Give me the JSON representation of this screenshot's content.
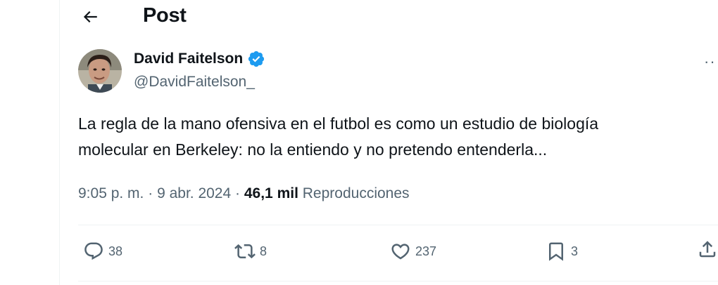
{
  "header": {
    "title": "Post",
    "back_icon": "arrow-left-icon"
  },
  "author": {
    "name": "David Faitelson",
    "handle": "@DavidFaitelson_",
    "verified": true,
    "verified_color": "#1d9bf0"
  },
  "tweet": {
    "text_line1": "La regla de la mano ofensiva en el futbol es como un estudio de biología",
    "text_line2": "molecular en Berkeley: no la entiendo y no pretendo entenderla...",
    "time": "9:05 p. m.",
    "separator": "·",
    "date": "9 abr. 2024",
    "views_count": "46,1 mil",
    "views_label": "Reproducciones"
  },
  "actions": {
    "replies": "38",
    "reposts": "8",
    "likes": "237",
    "bookmarks": "3"
  },
  "colors": {
    "text": "#0f1419",
    "secondary": "#536471",
    "border": "#eff3f4"
  }
}
